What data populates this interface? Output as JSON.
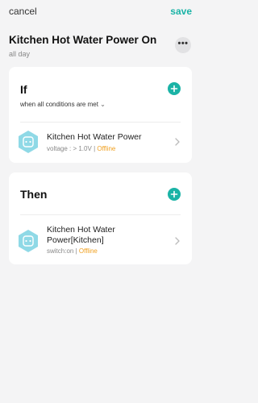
{
  "topbar": {
    "cancel_label": "cancel",
    "save_label": "save"
  },
  "scene": {
    "title": "Kitchen Hot Water Power On",
    "subtitle": "all day"
  },
  "more_icon": "more-horizontal-icon",
  "if_card": {
    "heading": "If",
    "conditions_text": "when all conditions are met",
    "items": [
      {
        "name": "Kitchen Hot Water Power",
        "detail": "voltage : > 1.0V",
        "separator": "|",
        "status": "Offline",
        "icon": "smart-plug-icon"
      }
    ]
  },
  "then_card": {
    "heading": "Then",
    "items": [
      {
        "name": "Kitchen Hot Water Power[Kitchen]",
        "detail": "switch:on",
        "separator": "|",
        "status": "Offline",
        "icon": "smart-plug-icon"
      }
    ]
  },
  "colors": {
    "accent": "#1ab3a6",
    "offline": "#f0a020",
    "icon_bg": "#8fd9e6"
  }
}
